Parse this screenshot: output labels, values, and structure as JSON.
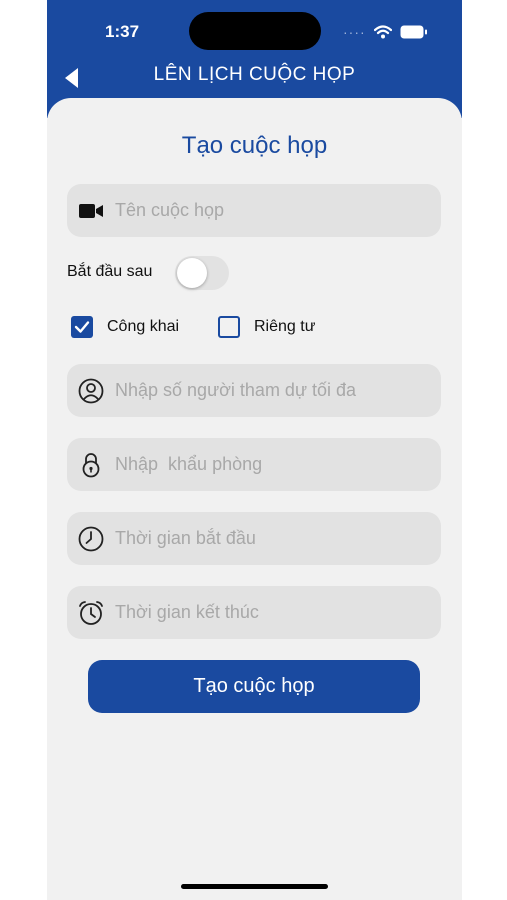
{
  "status": {
    "time": "1:37",
    "signal": "····"
  },
  "nav": {
    "title": "LÊN LỊCH CUỘC HỌP"
  },
  "form": {
    "heading": "Tạo cuộc họp",
    "meeting_name_placeholder": "Tên cuộc họp",
    "start_later_label": "Bắt đầu sau",
    "start_later_on": false,
    "public_label": "Công khai",
    "public_checked": true,
    "private_label": "Riêng tư",
    "private_checked": false,
    "max_participants_placeholder": "Nhập số người tham dự tối đa",
    "password_placeholder": "Nhập  khẩu phòng",
    "start_time_placeholder": "Thời gian bắt đầu",
    "end_time_placeholder": "Thời gian kết thúc",
    "submit_label": "Tạo cuộc họp"
  },
  "icons": {
    "back": "back-arrow-icon",
    "video": "video-camera-icon",
    "user": "user-circle-icon",
    "lock": "lock-icon",
    "clock": "clock-icon",
    "alarm": "alarm-clock-icon",
    "wifi": "wifi-icon",
    "battery": "battery-icon"
  },
  "colors": {
    "primary": "#1a4aa0",
    "field_bg": "#e2e2e2",
    "background": "#f1f1f1"
  }
}
